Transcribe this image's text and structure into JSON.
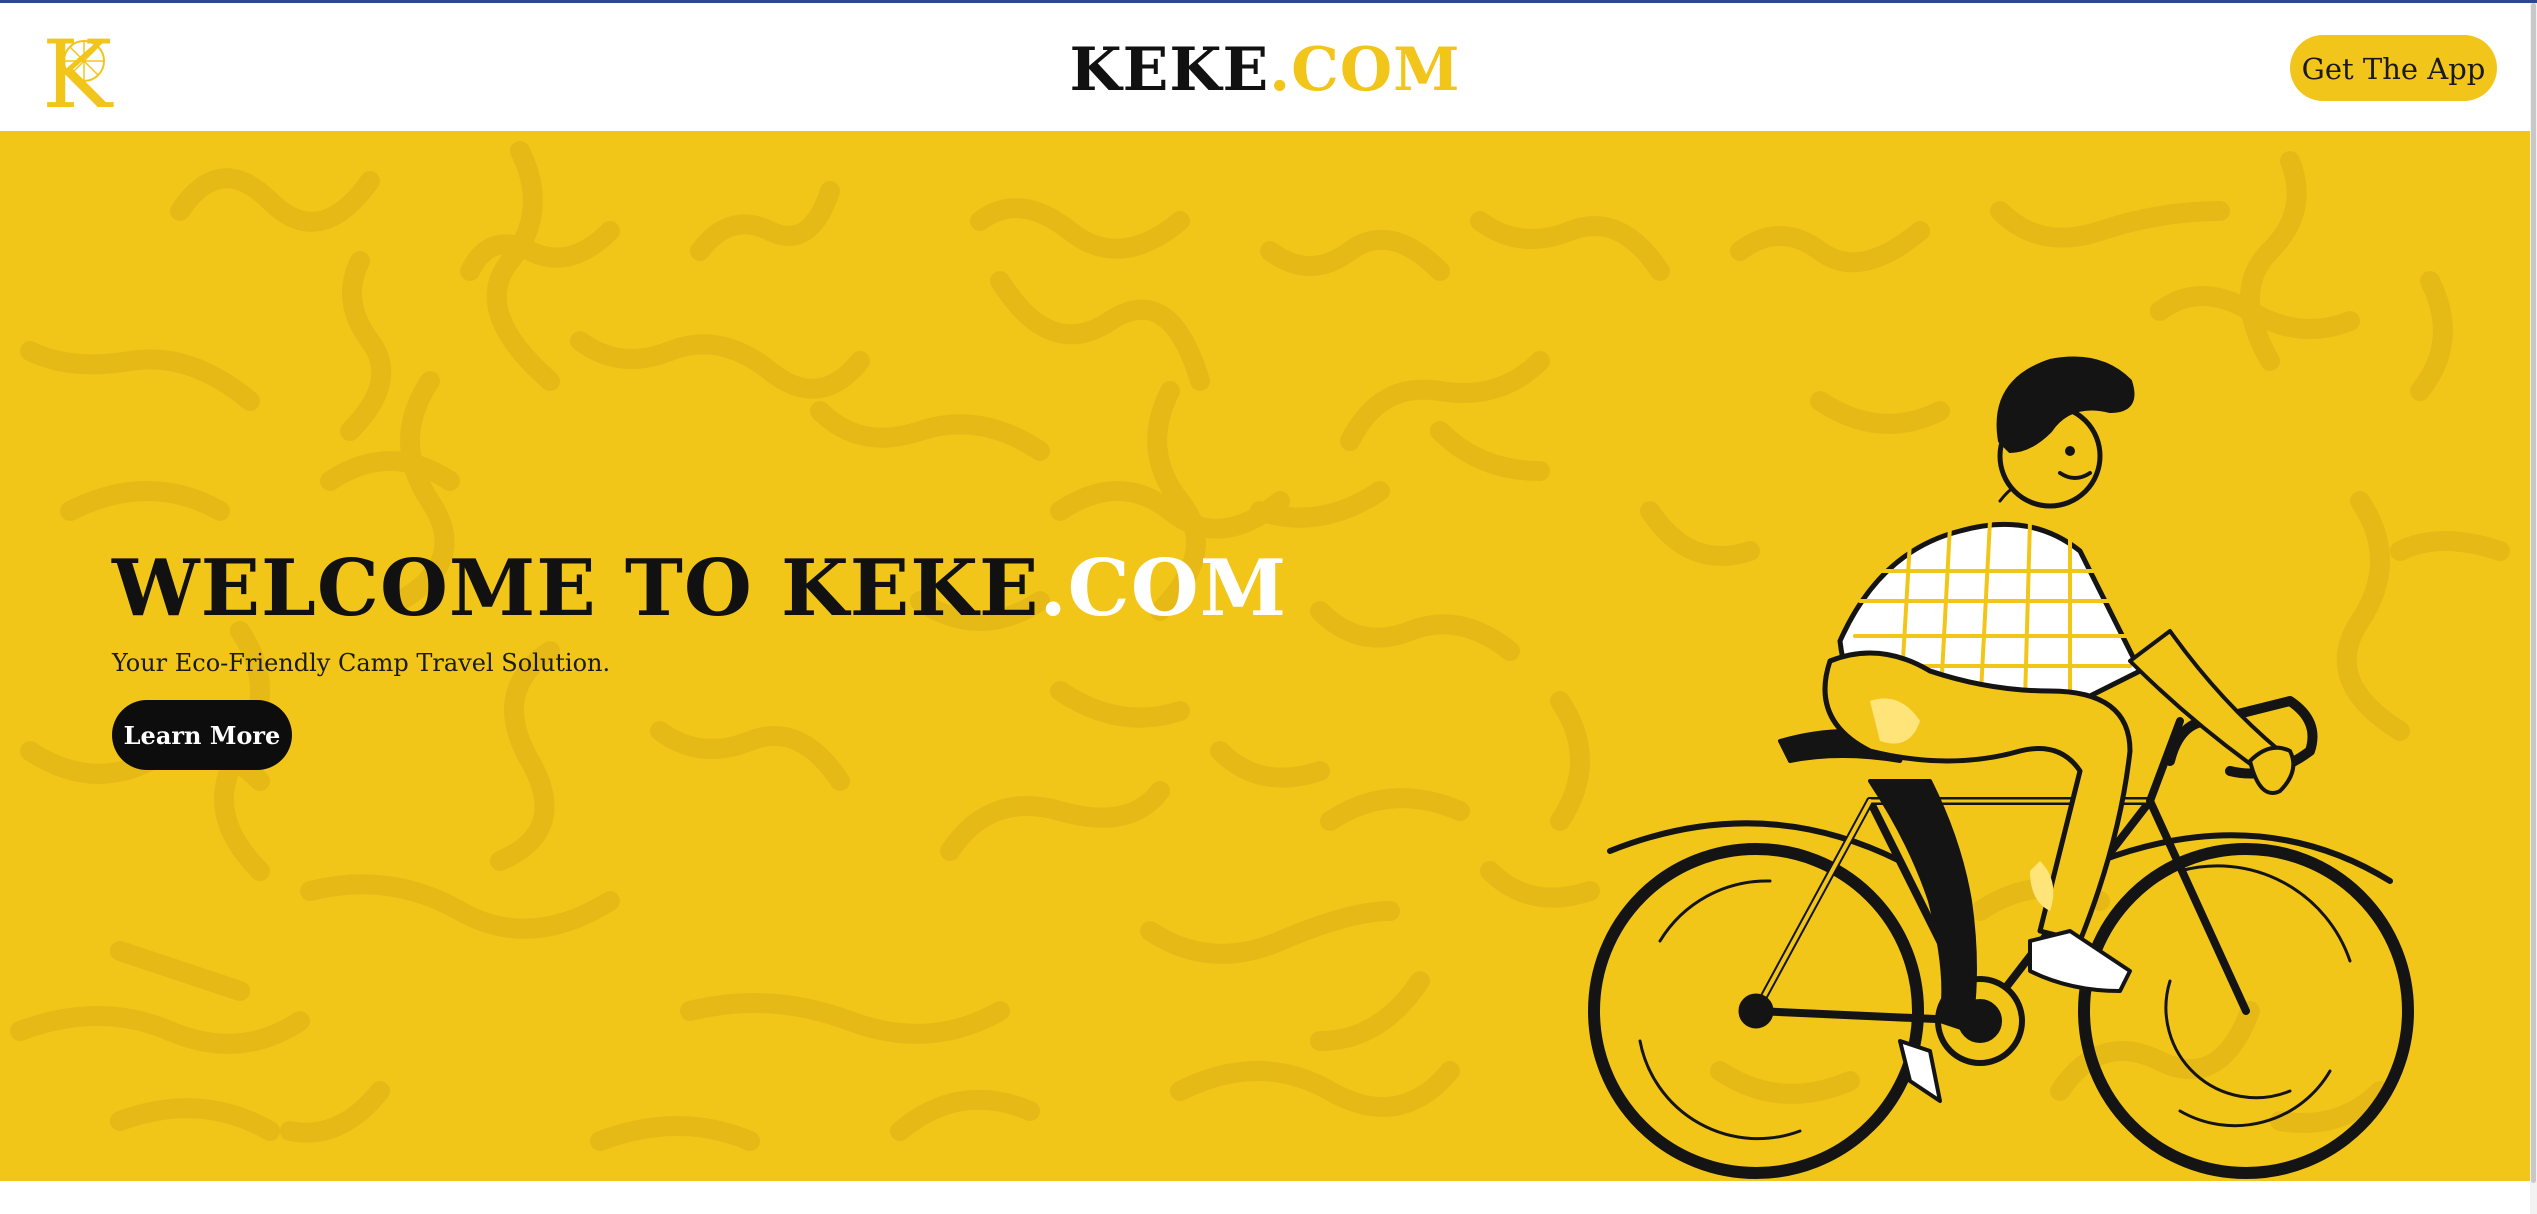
{
  "header": {
    "logo_letter": "K",
    "brand_primary": "KEKE",
    "brand_accent": ".COM",
    "get_app_label": "Get The App"
  },
  "hero": {
    "title_primary": "WELCOME TO KEKE",
    "title_accent": ".COM",
    "subtitle": "Your Eco-Friendly Camp Travel Solution.",
    "learn_more_label": "Learn More"
  },
  "colors": {
    "accent": "#f2c51a",
    "hero_background": "#f2c618",
    "dark": "#111111",
    "white": "#ffffff"
  },
  "icons": {
    "logo": "k-wheel-logo",
    "illustration": "cyclist-illustration"
  }
}
